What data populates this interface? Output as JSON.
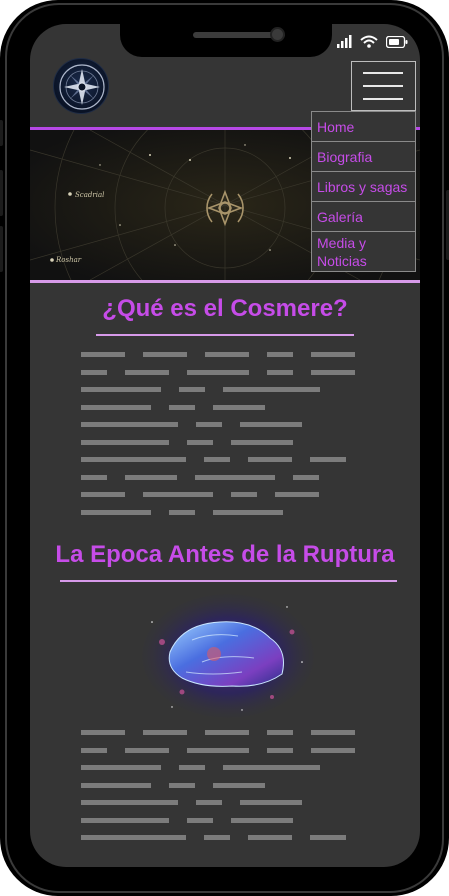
{
  "nav": {
    "items": [
      {
        "label": "Home"
      },
      {
        "label": "Biografia"
      },
      {
        "label": "Libros y sagas"
      },
      {
        "label": "Galería"
      },
      {
        "label": "Media y Noticias"
      }
    ]
  },
  "banner": {
    "map_labels": [
      "Scadrial",
      "Roshar"
    ]
  },
  "sections": [
    {
      "title": "¿Qué es el Cosmere?"
    },
    {
      "title": "La Epoca Antes de la Ruptura"
    }
  ],
  "colors": {
    "accent": "#c64ce8",
    "rule": "#d79ae9",
    "screen_bg": "#353535",
    "placeholder_text": "#7c7c7c"
  }
}
